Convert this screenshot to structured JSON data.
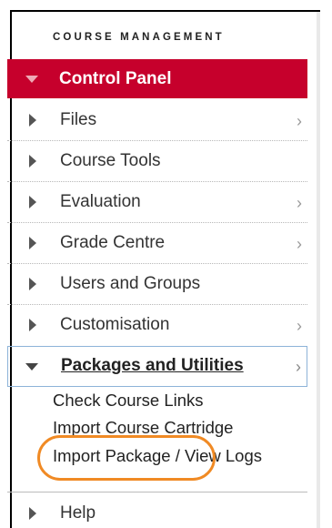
{
  "header": {
    "title": "COURSE MANAGEMENT"
  },
  "control_panel": {
    "label": "Control Panel",
    "color": "#c6002c"
  },
  "menu": {
    "files": {
      "label": "Files",
      "chevron": "›"
    },
    "course_tools": {
      "label": "Course Tools"
    },
    "evaluation": {
      "label": "Evaluation",
      "chevron": "›"
    },
    "grade_centre": {
      "label": "Grade Centre",
      "chevron": "›"
    },
    "users_groups": {
      "label": "Users and Groups"
    },
    "customisation": {
      "label": "Customisation",
      "chevron": "›"
    },
    "packages": {
      "label": "Packages and Utilities",
      "chevron": "›",
      "subitems": [
        {
          "label": "Check Course Links"
        },
        {
          "label": "Import Course Cartridge"
        },
        {
          "label": "Import Package / View Logs"
        }
      ]
    },
    "help": {
      "label": "Help"
    }
  },
  "annotation": {
    "highlight_color": "#f08a24"
  }
}
